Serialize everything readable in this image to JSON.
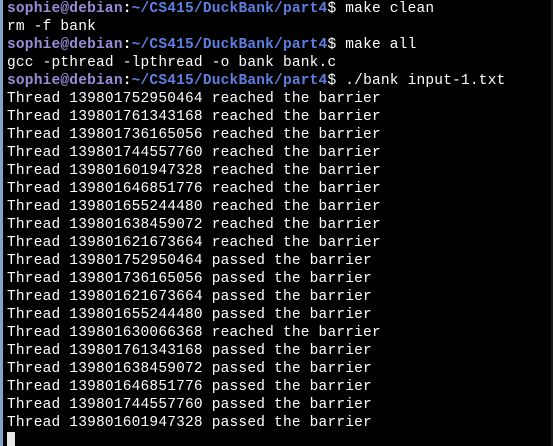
{
  "prompt": {
    "user_host": "sophie@debian",
    "colon": ":",
    "path": "~/CS415/DuckBank/part4",
    "symbol": "$"
  },
  "commands": [
    {
      "command": " make clean",
      "output": [
        "rm -f bank"
      ]
    },
    {
      "command": " make all",
      "output": [
        "gcc -pthread -lpthread -o bank bank.c"
      ]
    },
    {
      "command": " ./bank input-1.txt",
      "output": [
        "Thread 139801752950464 reached the barrier",
        "Thread 139801761343168 reached the barrier",
        "Thread 139801736165056 reached the barrier",
        "Thread 139801744557760 reached the barrier",
        "Thread 139801601947328 reached the barrier",
        "Thread 139801646851776 reached the barrier",
        "Thread 139801655244480 reached the barrier",
        "Thread 139801638459072 reached the barrier",
        "Thread 139801621673664 reached the barrier",
        "Thread 139801752950464 passed the barrier",
        "Thread 139801736165056 passed the barrier",
        "Thread 139801621673664 passed the barrier",
        "Thread 139801655244480 passed the barrier",
        "Thread 139801630066368 reached the barrier",
        "Thread 139801761343168 passed the barrier",
        "Thread 139801638459072 passed the barrier",
        "Thread 139801646851776 passed the barrier",
        "Thread 139801744557760 passed the barrier",
        "Thread 139801601947328 passed the barrier"
      ]
    }
  ]
}
